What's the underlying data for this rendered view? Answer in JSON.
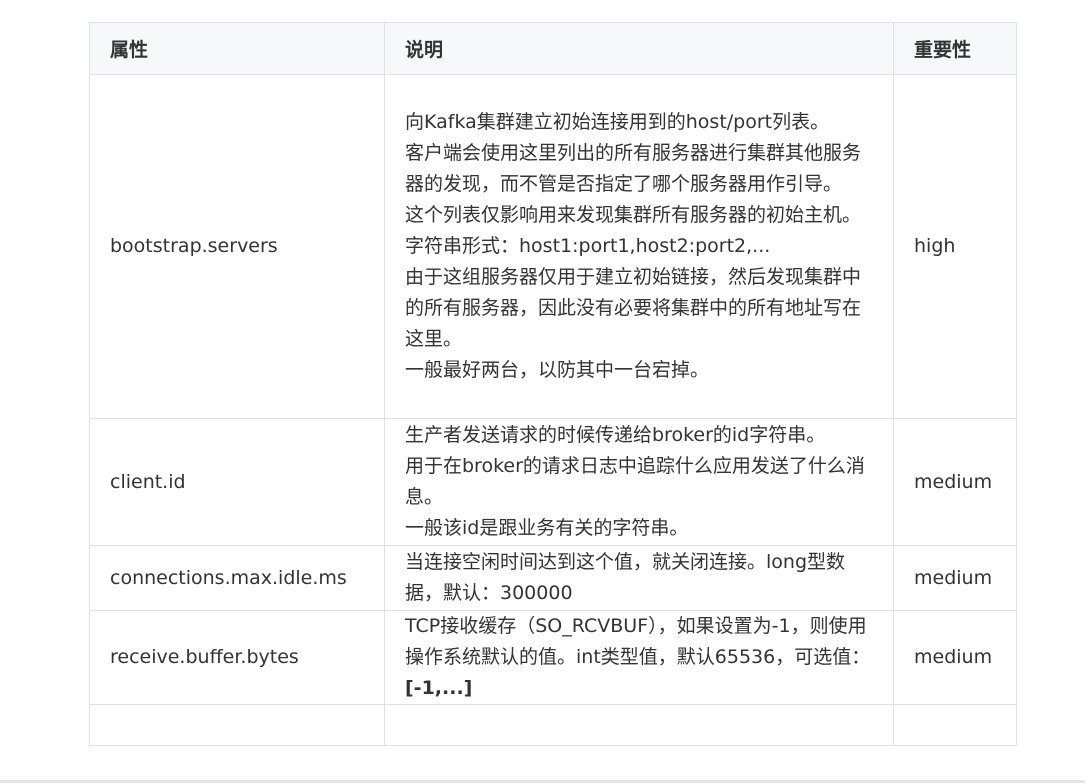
{
  "table": {
    "headers": [
      "属性",
      "说明",
      "重要性"
    ],
    "rows": [
      {
        "property": "bootstrap.servers",
        "description": [
          "向Kafka集群建立初始连接用到的host/port列表。",
          "客户端会使用这里列出的所有服务器进行集群其他服务器的发现，而不管是否指定了哪个服务器用作引导。",
          "这个列表仅影响用来发现集群所有服务器的初始主机。",
          "字符串形式：host1:port1,host2:port2,...",
          "由于这组服务器仅用于建立初始链接，然后发现集群中的所有服务器，因此没有必要将集群中的所有地址写在这里。",
          "一般最好两台，以防其中一台宕掉。"
        ],
        "importance": "high"
      },
      {
        "property": "client.id",
        "description": [
          "生产者发送请求的时候传递给broker的id字符串。",
          "用于在broker的请求日志中追踪什么应用发送了什么消息。",
          "一般该id是跟业务有关的字符串。"
        ],
        "importance": "medium"
      },
      {
        "property": "connections.max.idle.ms",
        "description": [
          "当连接空闲时间达到这个值，就关闭连接。long型数据，默认：300000"
        ],
        "importance": "medium"
      },
      {
        "property": "receive.buffer.bytes",
        "description_prefix": "TCP接收缓存（SO_RCVBUF），如果设置为-1，则使用操作系统默认的值。int类型值，默认65536，可选值：",
        "description_bold": "[-1,...]",
        "importance": "medium"
      }
    ]
  }
}
